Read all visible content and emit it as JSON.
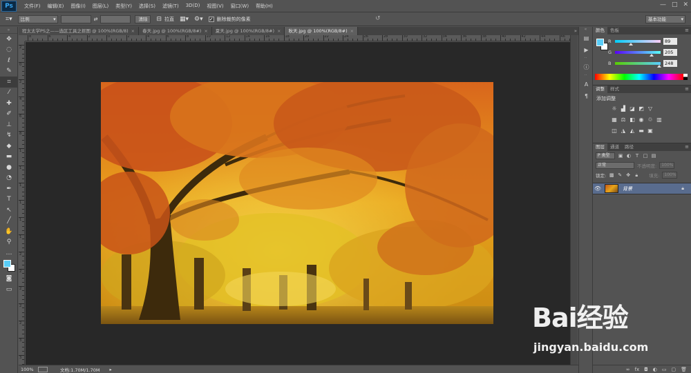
{
  "app": {
    "logo": "Ps",
    "menu": [
      "文件(F)",
      "编辑(E)",
      "图像(I)",
      "图层(L)",
      "类型(Y)",
      "选择(S)",
      "滤镜(T)",
      "3D(D)",
      "视图(V)",
      "窗口(W)",
      "帮助(H)"
    ],
    "window_controls": [
      "—",
      "□",
      "✕"
    ]
  },
  "options_bar": {
    "tool_icon": "crop-icon",
    "ratio_select": "比例",
    "swap_icon": "⇄",
    "clear_button": "清除",
    "straighten_label": "拉直",
    "delete_cropped_checked": true,
    "delete_cropped_label": "删除裁剪的像素",
    "workspace": "基本功能"
  },
  "tabs": [
    {
      "label": "程太太学PS之——选区工具之抠图 @ 100%(RGB/8)",
      "active": false
    },
    {
      "label": "春天.jpg @ 100%(RGB/8#)",
      "active": false
    },
    {
      "label": "夏天.jpg @ 100%(RGB/8#)",
      "active": false
    },
    {
      "label": "秋天.jpg @ 100%(RGB/8#)",
      "active": true
    }
  ],
  "tab_close": "×",
  "ruler": {
    "top_numbers": [
      "8",
      "6",
      "4",
      "2",
      "0",
      "2",
      "4",
      "6",
      "8",
      "10",
      "12",
      "14",
      "16",
      "18",
      "20",
      "22",
      "24",
      "26",
      "28",
      "30",
      "32",
      "34",
      "36",
      "38",
      "40",
      "42",
      "44",
      "46"
    ],
    "left_numbers": [
      "2",
      "0",
      "2",
      "4",
      "6",
      "8",
      "1",
      "1",
      "1",
      "1",
      "1",
      "1",
      "2",
      "2",
      "2",
      "2",
      "2",
      "3",
      "3"
    ]
  },
  "status": {
    "zoom": "100%",
    "doc": "文档:1.70M/1.70M"
  },
  "color_panel": {
    "tabs": [
      "颜色",
      "色板"
    ],
    "fg_color": "#59cdf8",
    "bg_color": "#ffffff",
    "channels": [
      {
        "label": "R",
        "value": "89",
        "fraction": 0.35
      },
      {
        "label": "G",
        "value": "205",
        "fraction": 0.8
      },
      {
        "label": "B",
        "value": "248",
        "fraction": 0.97
      }
    ]
  },
  "adjustments_panel": {
    "tabs": [
      "调整",
      "样式"
    ],
    "title": "添加调整"
  },
  "layers_panel": {
    "tabs": [
      "图层",
      "通道",
      "路径"
    ],
    "kind_filter": "P 类型",
    "blend_mode": "正常",
    "opacity_label": "不透明度:",
    "opacity_value": "100%",
    "lock_label": "锁定:",
    "fill_label": "填充:",
    "fill_value": "100%",
    "layers": [
      {
        "name": "背景",
        "visible": true,
        "locked": true
      }
    ]
  },
  "watermark": {
    "brand": "Bai经验",
    "url": "jingyan.baidu.com"
  }
}
